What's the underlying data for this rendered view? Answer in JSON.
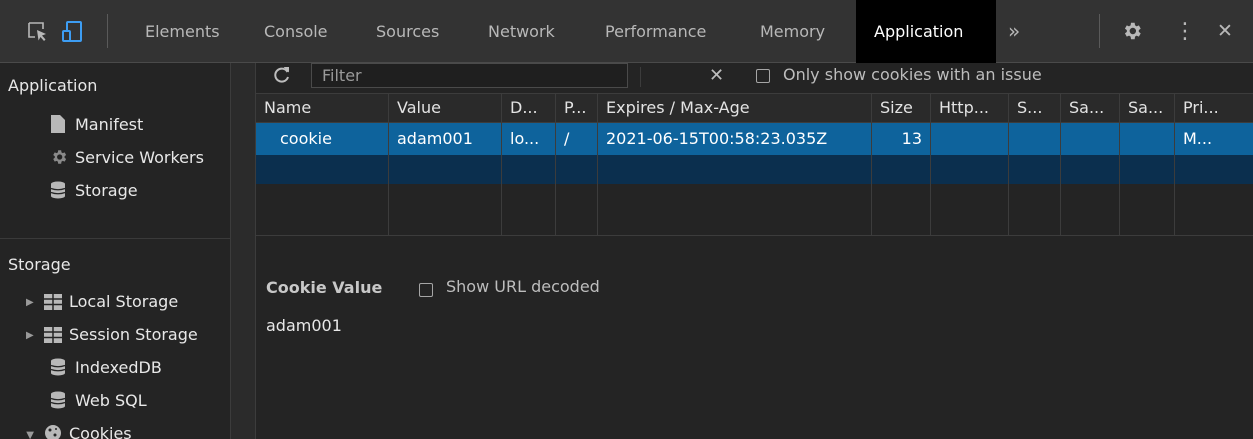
{
  "tabs": [
    "Elements",
    "Console",
    "Sources",
    "Network",
    "Performance",
    "Memory",
    "Application"
  ],
  "active_tab": "Application",
  "more_tabs_glyph": "»",
  "kebab_glyph": "⋮",
  "close_glyph": "✕",
  "sidebar": {
    "application_section": "Application",
    "application_items": [
      "Manifest",
      "Service Workers",
      "Storage"
    ],
    "storage_section": "Storage",
    "storage_items": [
      "Local Storage",
      "Session Storage",
      "IndexedDB",
      "Web SQL",
      "Cookies"
    ]
  },
  "toolbar": {
    "filter_placeholder": "Filter",
    "clear_glyph": "✕",
    "only_issue_label": "Only show cookies with an issue"
  },
  "table": {
    "columns": [
      "Name",
      "Value",
      "D...",
      "P...",
      "Expires / Max-Age",
      "Size",
      "Http...",
      "S...",
      "Sa...",
      "Sa...",
      "Pri..."
    ],
    "rows": [
      [
        "cookie",
        "adam001",
        "lo...",
        "/",
        "2021-06-15T00:58:23.035Z",
        "13",
        "",
        "",
        "",
        "",
        "M..."
      ]
    ]
  },
  "cookie_value": {
    "title": "Cookie Value",
    "show_decoded_label": "Show URL decoded",
    "value": "adam001"
  },
  "colors": {
    "selected_row": "#0e639c",
    "active_tab_bg": "#000000",
    "panel_bg": "#242424"
  }
}
